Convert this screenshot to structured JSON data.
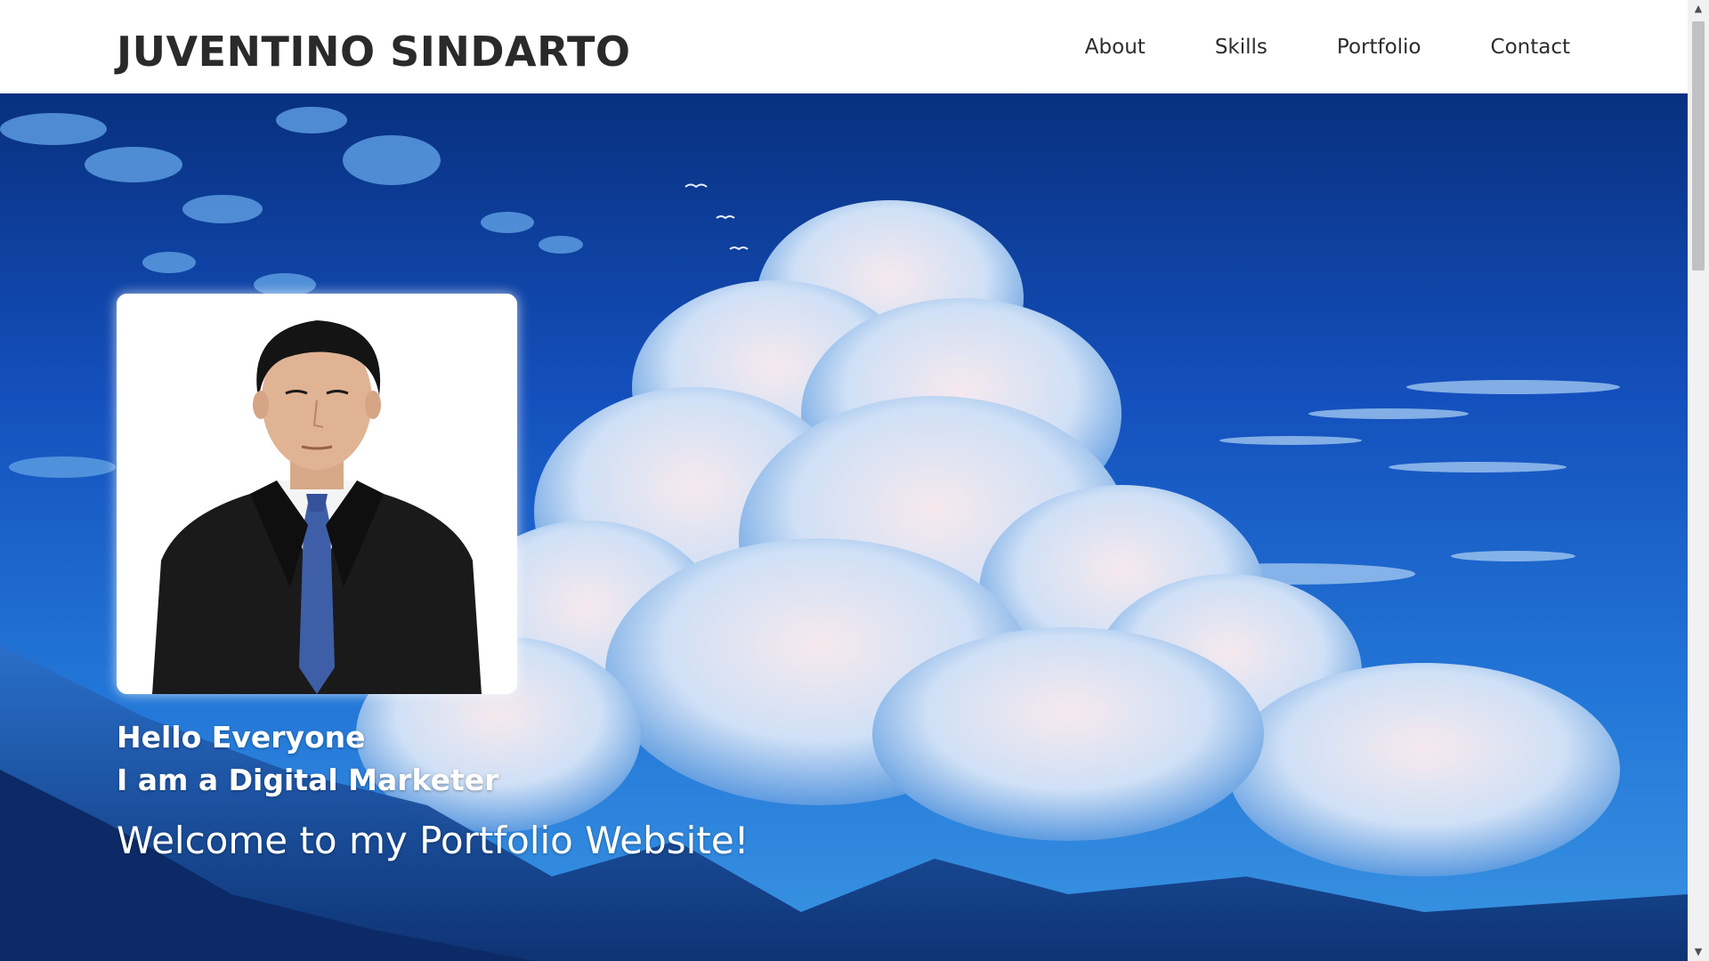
{
  "header": {
    "brand": "JUVENTINO SINDARTO",
    "nav": {
      "about": "About",
      "skills": "Skills",
      "portfolio": "Portfolio",
      "contact": "Contact"
    }
  },
  "hero": {
    "greeting_line1": "Hello Everyone",
    "greeting_line2": "I am a Digital Marketer",
    "welcome": "Welcome to my Portfolio Website!",
    "background": "anime-sky-clouds-mountains",
    "photo": "profile-photo-man-in-suit"
  },
  "colors": {
    "header_bg": "#ffffff",
    "brand_text": "#2a2a2a",
    "sky_top": "#0a2f8a",
    "sky_bottom": "#3d9be6",
    "hero_text": "#ffffff"
  },
  "scrollbar": {
    "up_icon": "▲",
    "down_icon": "▼"
  }
}
